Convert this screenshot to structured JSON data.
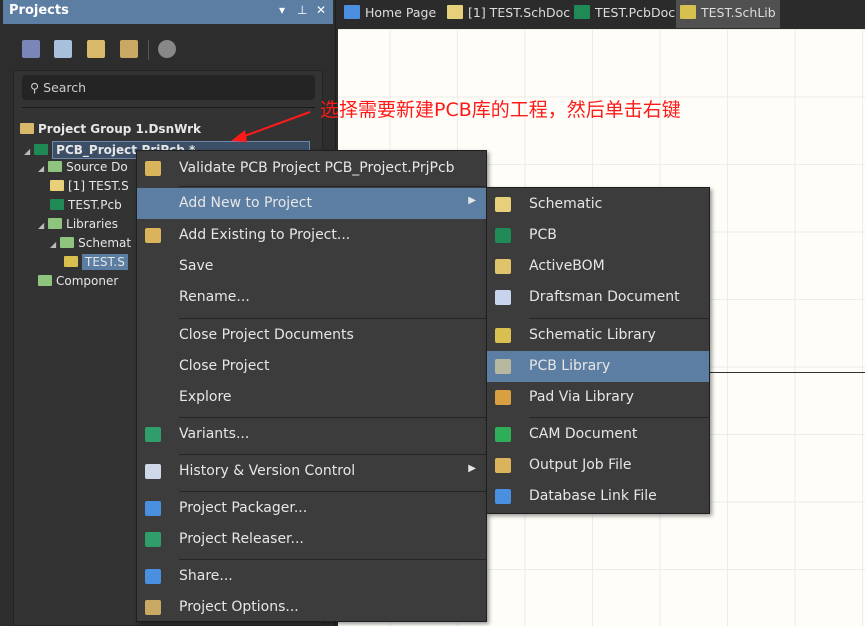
{
  "panel": {
    "title": "Projects",
    "controls": [
      "▾",
      "⊥",
      "✕"
    ],
    "search_placeholder": "Search",
    "tree": [
      {
        "label": "Project Group 1.DsnWrk",
        "depth": 0,
        "icon": "workspace-icon"
      },
      {
        "label": "PCB_Project.PrjPcb *",
        "depth": 1,
        "icon": "pcb-project-icon",
        "selected": true
      },
      {
        "label": "Source Do",
        "depth": 2,
        "icon": "folder-icon"
      },
      {
        "label": "[1] TEST.S",
        "depth": 3,
        "icon": "schematic-doc-icon"
      },
      {
        "label": "TEST.Pcb",
        "depth": 3,
        "icon": "pcb-doc-icon"
      },
      {
        "label": "Libraries",
        "depth": 2,
        "icon": "folder-icon"
      },
      {
        "label": "Schemat",
        "depth": 3,
        "icon": "folder-icon"
      },
      {
        "label": "TEST.S",
        "depth": 4,
        "icon": "schlib-icon",
        "selected": true
      },
      {
        "label": "Componer",
        "depth": 2,
        "icon": "folder-icon"
      }
    ]
  },
  "tabs": [
    {
      "label": "Home Page",
      "icon": "home-icon"
    },
    {
      "label": "[1] TEST.SchDoc",
      "icon": "schematic-doc-icon"
    },
    {
      "label": "TEST.PcbDoc",
      "icon": "pcb-doc-icon"
    },
    {
      "label": "TEST.SchLib",
      "icon": "schlib-icon",
      "active": true
    }
  ],
  "annotation": "选择需要新建PCB库的工程，然后单击右键",
  "context_menu": [
    {
      "label": "Validate PCB Project PCB_Project.PrjPcb",
      "icon": "validate-icon"
    },
    {
      "sep": true
    },
    {
      "label": "Add New to Project",
      "submenu": true,
      "highlighted": true
    },
    {
      "label": "Add Existing to Project...",
      "icon": "add-existing-icon"
    },
    {
      "label": "Save"
    },
    {
      "label": "Rename..."
    },
    {
      "sep": true
    },
    {
      "label": "Close Project Documents"
    },
    {
      "label": "Close Project"
    },
    {
      "label": "Explore"
    },
    {
      "sep": true
    },
    {
      "label": "Variants...",
      "icon": "variants-icon"
    },
    {
      "sep": true
    },
    {
      "label": "History & Version Control",
      "icon": "clock-icon",
      "submenu": true
    },
    {
      "sep": true
    },
    {
      "label": "Project Packager...",
      "icon": "packager-icon"
    },
    {
      "label": "Project Releaser...",
      "icon": "releaser-icon"
    },
    {
      "sep": true
    },
    {
      "label": "Share...",
      "icon": "share-icon"
    },
    {
      "label": "Project Options...",
      "icon": "options-icon"
    }
  ],
  "submenu": [
    {
      "label": "Schematic",
      "icon": "schematic-icon"
    },
    {
      "label": "PCB",
      "icon": "pcb-icon"
    },
    {
      "label": "ActiveBOM",
      "icon": "activebom-icon"
    },
    {
      "label": "Draftsman Document",
      "icon": "draftsman-icon"
    },
    {
      "sep": true
    },
    {
      "label": "Schematic Library",
      "icon": "schlib-icon"
    },
    {
      "label": "PCB Library",
      "icon": "pcblib-icon",
      "highlighted": true
    },
    {
      "label": "Pad Via Library",
      "icon": "padvia-icon"
    },
    {
      "sep": true
    },
    {
      "label": "CAM Document",
      "icon": "cam-icon"
    },
    {
      "label": "Output Job File",
      "icon": "outjob-icon"
    },
    {
      "label": "Database Link File",
      "icon": "dblink-icon"
    }
  ],
  "colors": {
    "highlight": "#5d7ea3",
    "menu_bg": "#3c3c3c",
    "annotation": "#ff1a1a"
  }
}
